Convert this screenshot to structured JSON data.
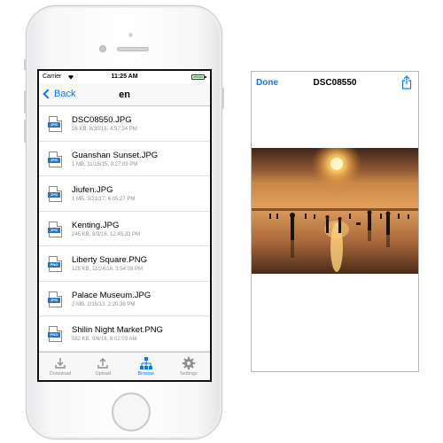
{
  "phone": {
    "status": {
      "carrier": "Carrier",
      "time": "11:25 AM"
    },
    "nav": {
      "back_label": "Back",
      "title": "en"
    },
    "files": [
      {
        "name": "DSC08550.JPG",
        "meta": "26 KB, 8/30/16, 4:57:24 PM",
        "type": "JPG"
      },
      {
        "name": "Guanshan Sunset.JPG",
        "meta": "1 MB, 11/15/15, 9:27:09 PM",
        "type": "JPG"
      },
      {
        "name": "Jiufen.JPG",
        "meta": "1 MB, 3/21/17, 6:05:27 PM",
        "type": "JPG"
      },
      {
        "name": "Kenting.JPG",
        "meta": "245 KB, 8/3/16, 12:45:33 PM",
        "type": "JPG"
      },
      {
        "name": "Liberty Square.PNG",
        "meta": "125 KB, 11/24/16, 3:54:09 PM",
        "type": "PNG"
      },
      {
        "name": "Palace Museum.JPG",
        "meta": "2 MB, 2/15/13, 2:20:36 PM",
        "type": "JPG"
      },
      {
        "name": "Shilin Night Market.PNG",
        "meta": "582 KB, 9/6/16, 8:02:03 AM",
        "type": "PNG"
      }
    ],
    "tabs": [
      {
        "label": "Download",
        "icon": "download-icon",
        "active": false
      },
      {
        "label": "Upload",
        "icon": "upload-icon",
        "active": false
      },
      {
        "label": "Browse",
        "icon": "browse-icon",
        "active": true
      },
      {
        "label": "Settings",
        "icon": "gear-icon",
        "active": false
      }
    ]
  },
  "preview": {
    "done_label": "Done",
    "title": "DSC08550",
    "share_icon": "share-icon",
    "image": "sunset-beach-photo"
  },
  "colors": {
    "accent": "#007aff",
    "file_tag": "#2a77c0",
    "sunset": "#e8812c"
  }
}
